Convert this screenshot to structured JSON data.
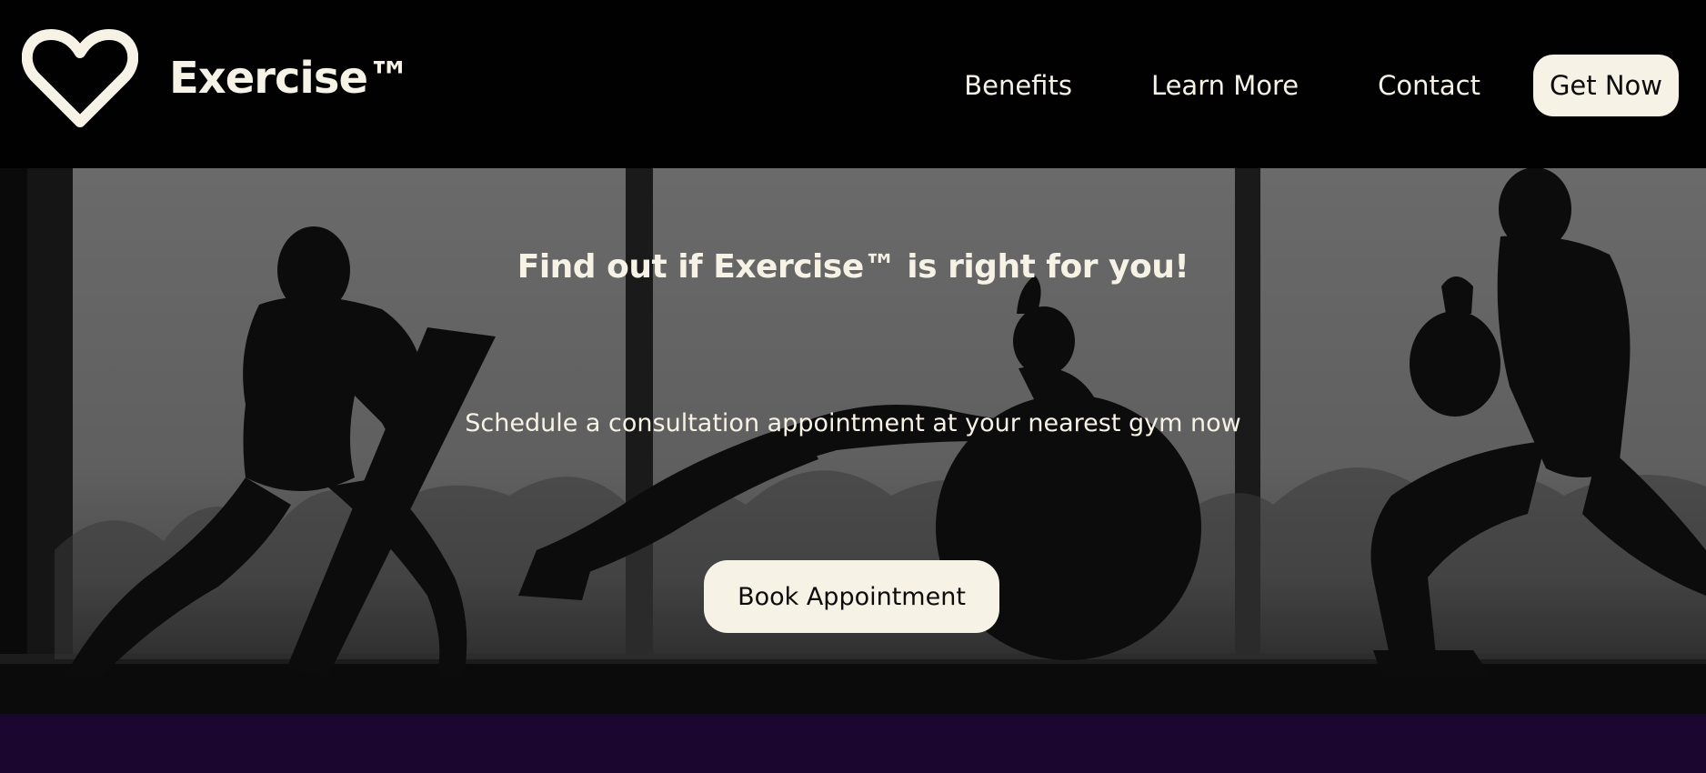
{
  "header": {
    "logo_icon": "heart-outline-icon",
    "brand": "Exercise™",
    "nav": [
      {
        "label": "Benefits"
      },
      {
        "label": "Learn More"
      },
      {
        "label": "Contact"
      }
    ],
    "cta_label": "Get Now"
  },
  "hero": {
    "background": "silhouettes of three people exercising in front of gym windows",
    "title": "Find out if Exercise™ is right for you!",
    "subtitle": "Schedule a consultation appointment at your nearest gym now",
    "button_label": "Book Appointment"
  },
  "colors": {
    "header_bg": "#020102",
    "text_light": "#f6f2e6",
    "button_bg": "#f6f2e6",
    "button_text": "#0d0b0b",
    "footer_band": "#1b0630"
  }
}
